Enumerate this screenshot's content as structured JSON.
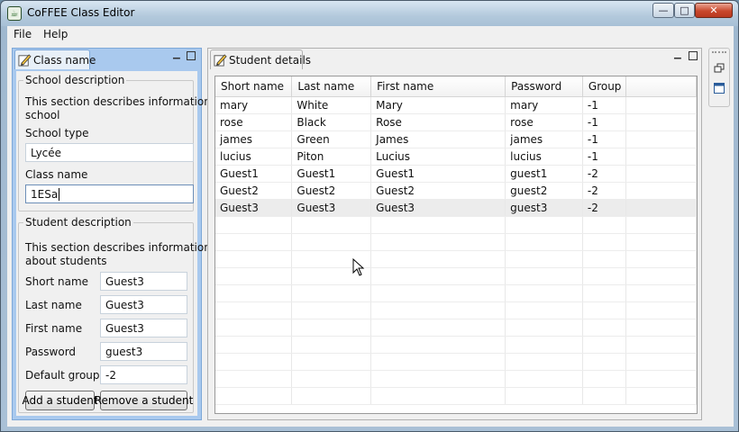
{
  "window": {
    "title": "CoFFEE Class Editor",
    "app_icon": "coffee-app-icon",
    "controls": {
      "minimize": "—",
      "maximize": "□",
      "close": "✕"
    }
  },
  "menu": {
    "file": "File",
    "help": "Help"
  },
  "left_view": {
    "tab_label": "Class name",
    "school": {
      "title": "School description",
      "desc_line1": "This section describes information a",
      "desc_line2": "school",
      "type_label": "School type",
      "type_value": "Lycée",
      "class_label": "Class name",
      "class_value": "1ESa"
    },
    "student": {
      "title": "Student description",
      "desc_line1": "This section describes information",
      "desc_line2": "about students",
      "short_label": "Short name",
      "short_value": "Guest3",
      "last_label": "Last name",
      "last_value": "Guest3",
      "first_label": "First name",
      "first_value": "Guest3",
      "password_label": "Password",
      "password_value": "guest3",
      "group_label": "Default group",
      "group_value": "-2",
      "add_button": "Add a student",
      "remove_button": "Remove a student"
    }
  },
  "right_view": {
    "tab_label": "Student details",
    "columns": [
      "Short name",
      "Last name",
      "First name",
      "Password",
      "Group"
    ],
    "rows": [
      [
        "mary",
        "White",
        "Mary",
        "mary",
        "-1"
      ],
      [
        "rose",
        "Black",
        "Rose",
        "rose",
        "-1"
      ],
      [
        "james",
        "Green",
        "James",
        "james",
        "-1"
      ],
      [
        "lucius",
        "Piton",
        "Lucius",
        "lucius",
        "-1"
      ],
      [
        "Guest1",
        "Guest1",
        "Guest1",
        "guest1",
        "-2"
      ],
      [
        "Guest2",
        "Guest2",
        "Guest2",
        "guest2",
        "-2"
      ],
      [
        "Guest3",
        "Guest3",
        "Guest3",
        "guest3",
        "-2"
      ]
    ],
    "selected_row": 6
  },
  "colors": {
    "active_view": "#a9c9ee",
    "selected_row": "#ececec",
    "close_button": "#c9482d"
  }
}
